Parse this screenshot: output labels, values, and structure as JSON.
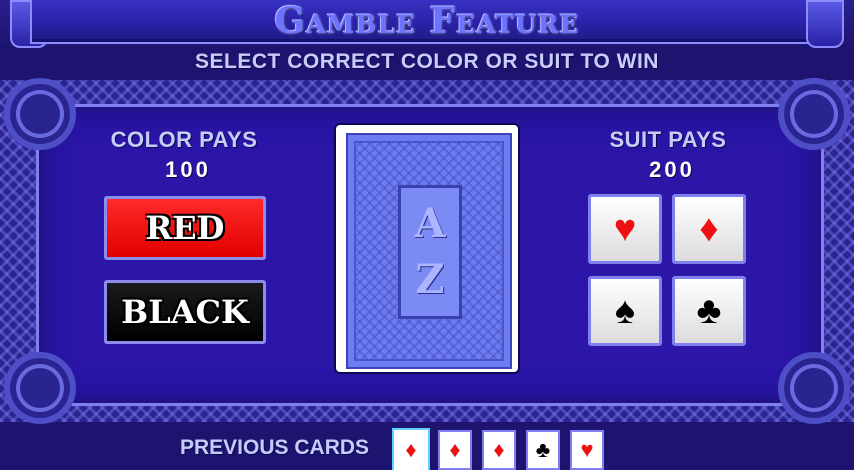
{
  "header": {
    "title": "Gamble Feature",
    "subtitle": "SELECT CORRECT COLOR OR SUIT TO WIN"
  },
  "color_pays": {
    "label": "COLOR PAYS",
    "value": "100",
    "buttons": [
      {
        "label": "RED",
        "color": "#ff1a1a"
      },
      {
        "label": "BLACK",
        "color": "#000000"
      }
    ]
  },
  "card_back": {
    "monogram": [
      "A",
      "Z"
    ]
  },
  "suit_pays": {
    "label": "SUIT PAYS",
    "value": "200",
    "suits": [
      {
        "name": "hearts",
        "glyph": "♥",
        "color": "#ee1111"
      },
      {
        "name": "diamonds",
        "glyph": "♦",
        "color": "#ee1111"
      },
      {
        "name": "spades",
        "glyph": "♠",
        "color": "#000000"
      },
      {
        "name": "clubs",
        "glyph": "♣",
        "color": "#000000"
      }
    ]
  },
  "previous_cards": {
    "label": "PREVIOUS CARDS",
    "cards": [
      {
        "suit": "diamonds",
        "glyph": "♦",
        "color": "#ee1111"
      },
      {
        "suit": "diamonds",
        "glyph": "♦",
        "color": "#ee1111"
      },
      {
        "suit": "diamonds",
        "glyph": "♦",
        "color": "#ee1111"
      },
      {
        "suit": "clubs",
        "glyph": "♣",
        "color": "#000000"
      },
      {
        "suit": "hearts",
        "glyph": "♥",
        "color": "#ee1111"
      }
    ]
  },
  "colors": {
    "background": "#1e1470",
    "panel": "#2b16a8",
    "accent": "#8c8cff",
    "label_text": "#c6ccf8"
  }
}
